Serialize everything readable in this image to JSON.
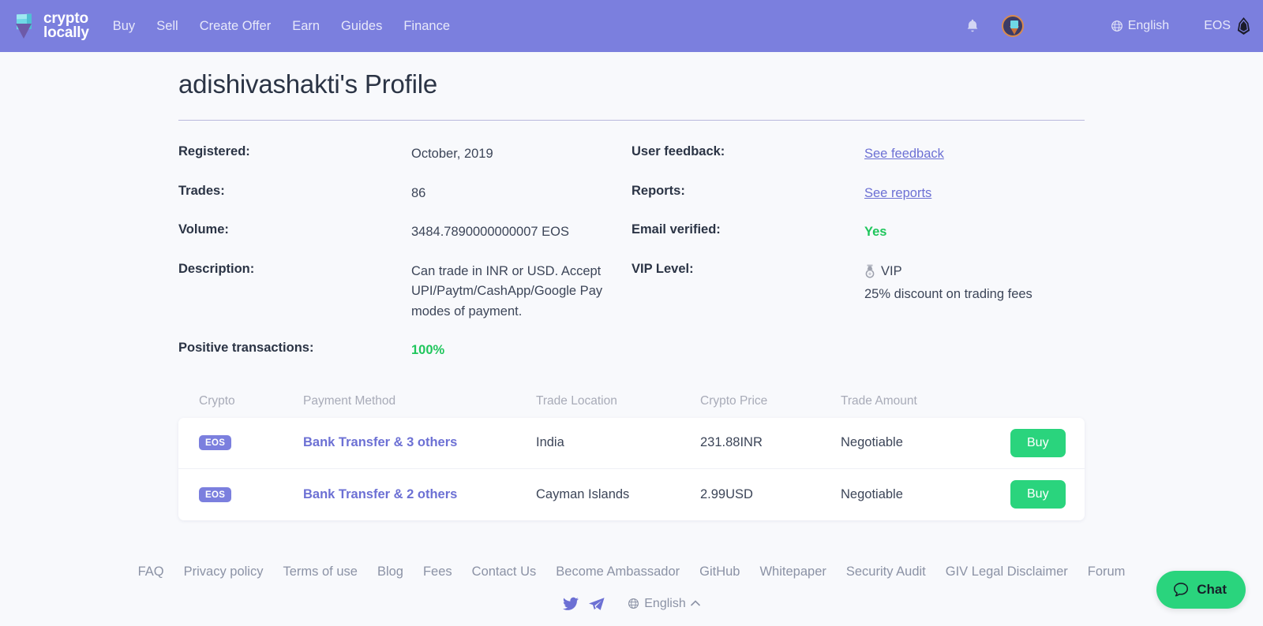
{
  "header": {
    "brand": {
      "line1": "crypto",
      "line2": "locally"
    },
    "nav": [
      {
        "label": "Buy"
      },
      {
        "label": "Sell"
      },
      {
        "label": "Create Offer"
      },
      {
        "label": "Earn"
      },
      {
        "label": "Guides"
      },
      {
        "label": "Finance"
      }
    ],
    "notifications_icon": "bell-icon",
    "avatar_icon": "user-avatar",
    "language": "English",
    "currency": "EOS",
    "accent_color": "#7b7fde"
  },
  "profile": {
    "title": "adishivashakti's Profile",
    "left": [
      {
        "label": "Registered:",
        "value": "October, 2019"
      },
      {
        "label": "Trades:",
        "value": "86"
      },
      {
        "label": "Volume:",
        "value": "3484.7890000000007 EOS"
      },
      {
        "label": "Description:",
        "value": "Can trade in INR or USD. Accept UPI/Paytm/CashApp/Google Pay modes of payment."
      },
      {
        "label": "Positive transactions:",
        "value": "100%"
      }
    ],
    "right": [
      {
        "label": "User feedback:",
        "value": "See feedback"
      },
      {
        "label": "Reports:",
        "value": "See reports"
      },
      {
        "label": "Email verified:",
        "value": "Yes"
      },
      {
        "label": "VIP Level:",
        "value": "VIP",
        "sub": "25% discount on trading fees"
      }
    ],
    "positive_color": "#1fc65c",
    "verified_color": "#1fc65c"
  },
  "offers_table": {
    "columns": [
      "Crypto",
      "Payment Method",
      "Trade Location",
      "Crypto Price",
      "Trade Amount"
    ],
    "rows": [
      {
        "crypto": "EOS",
        "payment_method": "Bank Transfer & 3 others",
        "trade_location": "India",
        "crypto_price": "231.88INR",
        "trade_amount": "Negotiable",
        "action": "Buy"
      },
      {
        "crypto": "EOS",
        "payment_method": "Bank Transfer & 2 others",
        "trade_location": "Cayman Islands",
        "crypto_price": "2.99USD",
        "trade_amount": "Negotiable",
        "action": "Buy"
      }
    ],
    "buy_color": "#2ad47d"
  },
  "footer": {
    "links": [
      "FAQ",
      "Privacy policy",
      "Terms of use",
      "Blog",
      "Fees",
      "Contact Us",
      "Become Ambassador",
      "GitHub",
      "Whitepaper",
      "Security Audit",
      "GIV Legal Disclaimer",
      "Forum"
    ],
    "socials": [
      "twitter-icon",
      "telegram-icon"
    ],
    "language": "English"
  },
  "chat": {
    "label": "Chat",
    "icon": "chat-bubble-icon"
  }
}
